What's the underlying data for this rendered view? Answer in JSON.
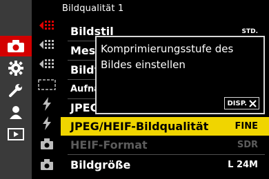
{
  "menu_title": "Bildqualität 1",
  "tabs": [
    {
      "name": "camera-icon",
      "active": true
    },
    {
      "name": "gear-icon",
      "active": false
    },
    {
      "name": "wrench-icon",
      "active": false
    },
    {
      "name": "person-icon",
      "active": false
    },
    {
      "name": "playback-icon",
      "active": false
    }
  ],
  "menu_items": [
    {
      "label": "Bildstil",
      "value": "STD.",
      "state": "normal"
    },
    {
      "label": "Messmethode",
      "value": "",
      "state": "normal"
    },
    {
      "label": "Bildverhältnis",
      "value": "",
      "state": "normal"
    },
    {
      "label": "Aufnahmemodus",
      "value": "",
      "state": "normal"
    },
    {
      "label": "JPEG",
      "value": "",
      "state": "normal"
    },
    {
      "label": "JPEG/HEIF-Bildqualität",
      "value": "FINE",
      "state": "selected"
    },
    {
      "label": "HEIF-Format",
      "value": "SDR",
      "state": "disabled"
    },
    {
      "label": "Bildgröße",
      "value": "L 24M",
      "state": "normal"
    }
  ],
  "help": {
    "text": "Komprimierungsstufe des Bildes einstellen",
    "close_label": "DISP.",
    "close_icon": "close-icon"
  },
  "colors": {
    "selected_bg": "#f0d500",
    "active_tab": "#d30000",
    "popup_border": "#d8d8d8"
  }
}
